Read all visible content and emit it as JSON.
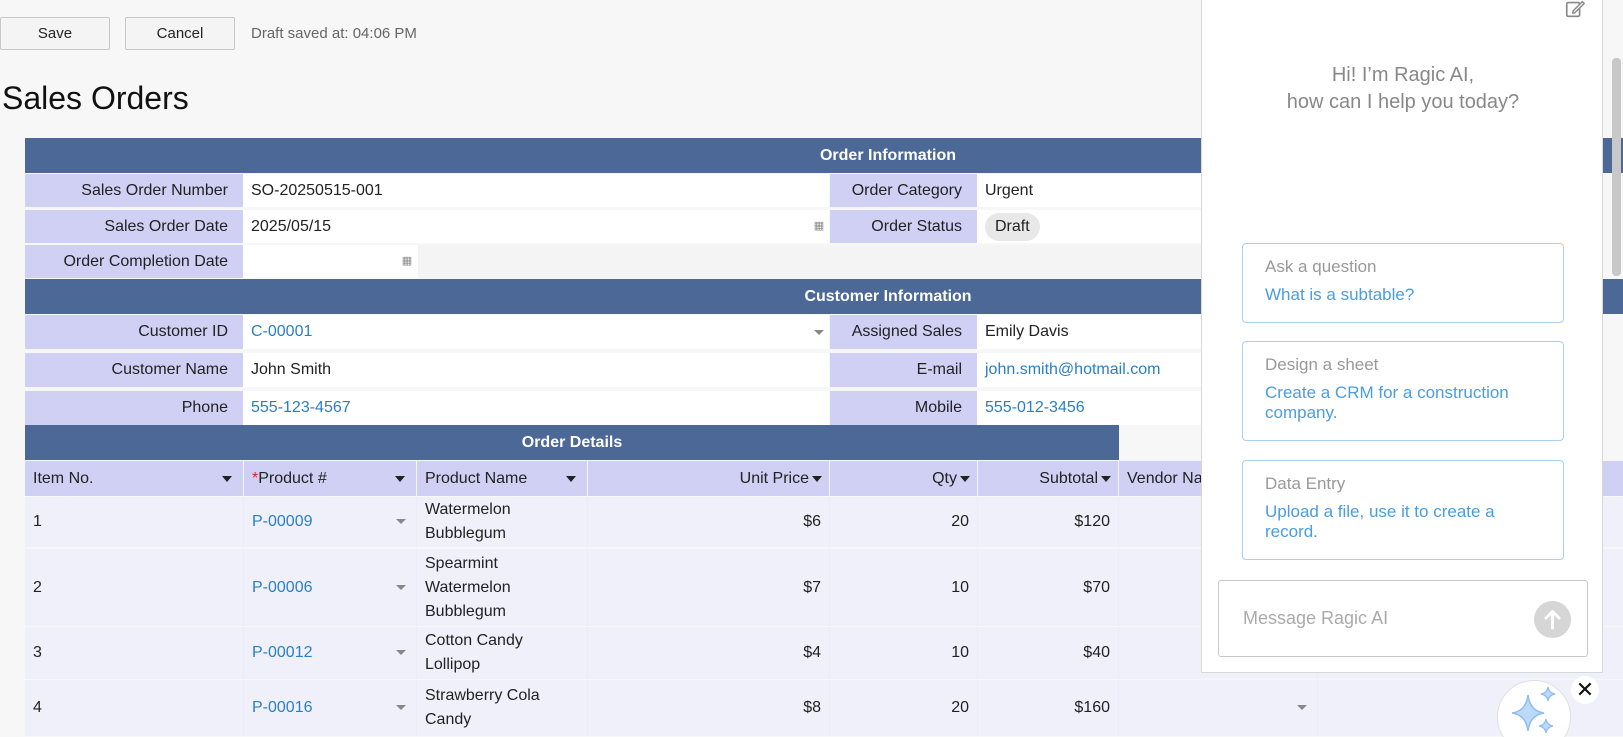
{
  "toolbar": {
    "save_label": "Save",
    "cancel_label": "Cancel",
    "draft_status": "Draft saved at: 04:06 PM"
  },
  "page_title": "Sales Orders",
  "sections": {
    "order_info": "Order Information",
    "customer_info": "Customer Information",
    "order_details": "Order Details"
  },
  "order_info": {
    "sales_order_number_label": "Sales Order Number",
    "sales_order_number": "SO-20250515-001",
    "order_category_label": "Order Category",
    "order_category": "Urgent",
    "sales_order_date_label": "Sales Order Date",
    "sales_order_date": "2025/05/15",
    "order_status_label": "Order Status",
    "order_status": "Draft",
    "order_completion_date_label": "Order Completion Date",
    "order_completion_date": ""
  },
  "customer_info": {
    "customer_id_label": "Customer ID",
    "customer_id": "C-00001",
    "assigned_sales_label": "Assigned Sales",
    "assigned_sales": "Emily Davis",
    "customer_name_label": "Customer Name",
    "customer_name": "John Smith",
    "email_label": "E-mail",
    "email": "john.smith@hotmail.com",
    "phone_label": "Phone",
    "phone": "555-123-4567",
    "mobile_label": "Mobile",
    "mobile": "555-012-3456"
  },
  "order_details": {
    "columns": {
      "item_no": "Item No.",
      "product_required": "*",
      "product_no": "Product #",
      "product_name": "Product Name",
      "unit_price": "Unit Price",
      "qty": "Qty",
      "subtotal": "Subtotal",
      "vendor": "Vendor Na"
    },
    "rows": [
      {
        "item_no": "1",
        "product_no": "P-00009",
        "product_name": "Watermelon Bubblegum",
        "unit_price": "$6",
        "qty": "20",
        "subtotal": "$120"
      },
      {
        "item_no": "2",
        "product_no": "P-00006",
        "product_name": "Spearmint Watermelon Bubblegum",
        "unit_price": "$7",
        "qty": "10",
        "subtotal": "$70"
      },
      {
        "item_no": "3",
        "product_no": "P-00012",
        "product_name": "Cotton Candy Lollipop",
        "unit_price": "$4",
        "qty": "10",
        "subtotal": "$40"
      },
      {
        "item_no": "4",
        "product_no": "P-00016",
        "product_name": "Strawberry Cola Candy",
        "unit_price": "$8",
        "qty": "20",
        "subtotal": "$160"
      }
    ]
  },
  "ai_panel": {
    "greeting_line1": "Hi! I’m Ragic AI,",
    "greeting_line2": "how can I help you today?",
    "cards": [
      {
        "title": "Ask a question",
        "text": "What is a subtable?"
      },
      {
        "title": "Design a sheet",
        "text": "Create a CRM for a construction company."
      },
      {
        "title": "Data Entry",
        "text": "Upload a file, use it to create a record."
      }
    ],
    "message_placeholder": "Message Ragic AI",
    "close_symbol": "✕"
  },
  "colors": {
    "section_header": "#4b6897",
    "label_bg": "#d0d0f5",
    "link": "#2a7fc4",
    "ai_link": "#4a9de0",
    "row_bg": "#f0f0fb"
  }
}
